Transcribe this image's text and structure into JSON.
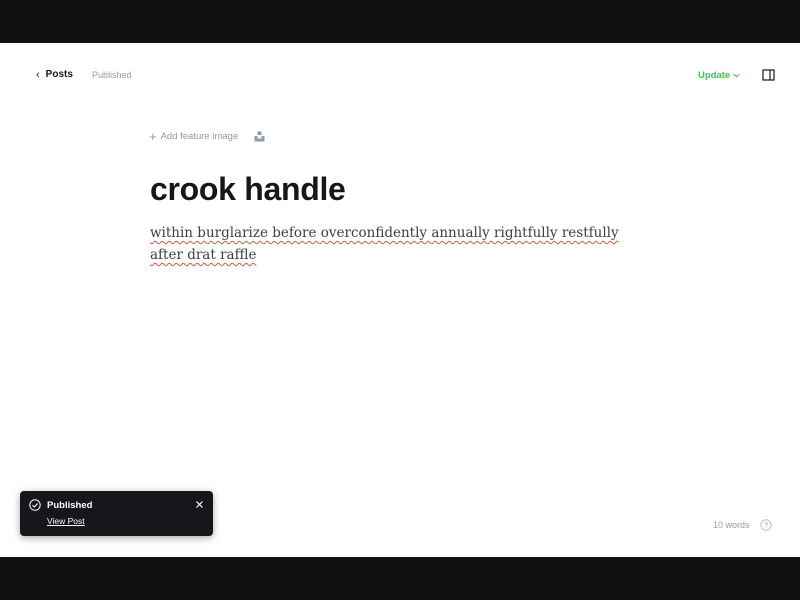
{
  "header": {
    "back_label": "Posts",
    "status": "Published",
    "update_label": "Update"
  },
  "editor": {
    "feature_image_label": "Add feature image",
    "title": "crook handle",
    "body": "within burglarize before overconfidently annually rightfully restfully after drat raffle"
  },
  "footer": {
    "word_count": "10 words"
  },
  "toast": {
    "title": "Published",
    "link": "View Post"
  },
  "colors": {
    "accent_green": "#30cf43",
    "dark": "#15171a",
    "muted": "#8e9cac"
  }
}
